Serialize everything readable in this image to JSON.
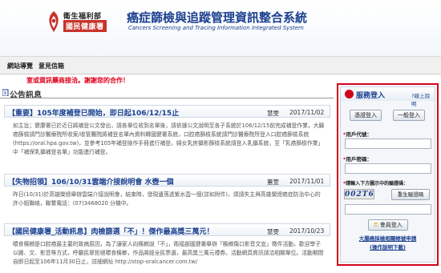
{
  "header": {
    "ministry": "衛生福利部",
    "agency": "國民健康署",
    "title": "癌症篩檢與追蹤管理資訊整合系統",
    "subtitle": "Cancers Screening and Tracing Information Integrated System",
    "brand_color": "#c8322b",
    "title_color": "#1a3f8f"
  },
  "nav": {
    "items": [
      {
        "label": "網站導覽"
      },
      {
        "label": "意見信箱"
      }
    ]
  },
  "marquee": {
    "text": "室或資訊藥商接洽。謝謝您的合作！",
    "color": "#e0001b"
  },
  "announcements": {
    "icon": "announcement-icon",
    "title": "公告訊息",
    "posts": [
      {
        "title": "【重要】105年度補登已開始，即日起106/12/15止",
        "author": "慧雯",
        "date": "2017/11/02",
        "body": "如主旨；健康署已於近日將補登公文發出，請各單位收到名單後，請依據公文說明至各子系統於106/12/15前完成補登作業，大腸癌篩檢請門診醫療院所收案/收管醫院將補登名單內資料轉國健署系統，口腔癌篩檢系統請門診醫療院所登入口腔癌篩檢系統(https://oral.hpa.gov.tw)，並參考105年補登操作手冊進行補登，婦女乳房攝影篩檢系統請登入乳攝系統，至「乳癌篩檢作業」中「補保乳攝補登名單」功能進行補登。"
      },
      {
        "title": "【失物招領】106/10/31雲端介接說明會 水壺一個",
        "author": "蕙萱",
        "date": "2017/11/01",
        "body": "昨日(10/31)於高雄榮總舉辦雲端介接說明會，結束時，發現遺落透紫水壺一個(詳如附件)，煩請失主與高雄榮總癌症防治中心的許小姐聯絡，聯繫電話：(07)3468020 分機中。"
      },
      {
        "title": "【國民健康署_活動訊息】肉檢篩選「不」！傑作最高獎三萬元！",
        "author": "慧雯",
        "date": "2017/10/23",
        "body": "嚼食檳榔是口腔癌最主要的致病原因，為了讓家人向檳榔說「不」，衛福部國健署舉辦「檳榔傷口影音文宣」徵件活動，歡迎學子以圖、文、影音等方式，呼籲民眾拒絕嚼食檳榔，作品將經全民票選，最高獎三萬元禮券。活動網頁資訊請洽相關單位。活動期間自即日起至106年11月30日止，詳細網址 http://stop-oralcancer.com.tw/"
      }
    ]
  },
  "login": {
    "title": "服務登入",
    "help": "?線上說明",
    "cert_button": "憑證登入",
    "normal_button": "一般登入",
    "username_label": "用戶代號：",
    "password_label": "用戶密碼：",
    "captcha_label": "請輸入下方圖示中的驗證碼：",
    "captcha_text": "002T6",
    "refresh_button": "重生驗證碼",
    "login_button": "會員登入",
    "link_apply": "大腸癌採檢相關帳號申請",
    "link_manual": "(操作說明下載)",
    "border_color": "#d0021b"
  }
}
